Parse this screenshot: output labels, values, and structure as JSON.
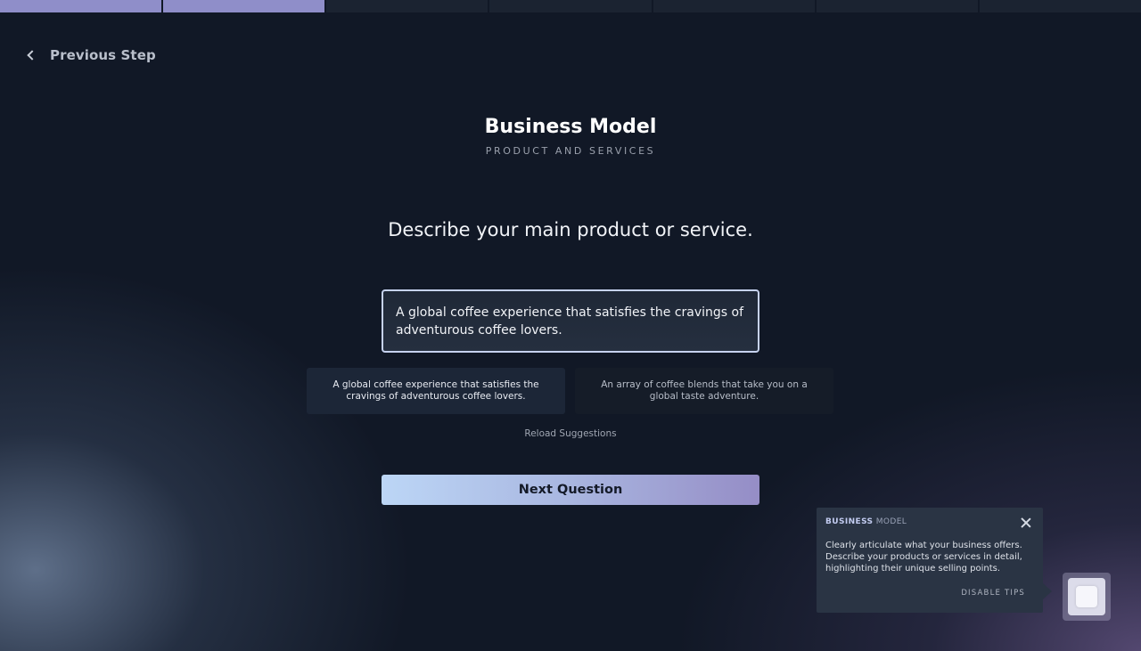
{
  "progress": {
    "total_steps": 7,
    "completed_steps": 2,
    "done_color": "#8f8ec9",
    "pending_color": "#1b2331"
  },
  "nav": {
    "previous_label": "Previous Step",
    "previous_icon": "chevron-left-icon"
  },
  "header": {
    "title": "Business Model",
    "subtitle": "PRODUCT AND SERVICES"
  },
  "question": {
    "text": "Describe your main product or service."
  },
  "answer": {
    "value": "A global coffee experience that satisfies the cravings of adventurous coffee lovers."
  },
  "suggestions": [
    {
      "text": "A global coffee experience that satisfies the cravings of adventurous coffee lovers."
    },
    {
      "text": "An array of coffee blends that take you on a global taste adventure."
    }
  ],
  "reload_label": "Reload Suggestions",
  "next_label": "Next Question",
  "tip": {
    "heading_strong": "BUSINESS",
    "heading_light": "MODEL",
    "body": "Clearly articulate what your business offers. Describe your products or services in detail, highlighting their unique selling points.",
    "disable_label": "DISABLE TIPS",
    "close_icon": "close-icon"
  },
  "assistant": {
    "icon": "assistant-icon"
  },
  "colors": {
    "accent_start": "#bcd6f6",
    "accent_end": "#958dc6",
    "background": "#111826"
  }
}
